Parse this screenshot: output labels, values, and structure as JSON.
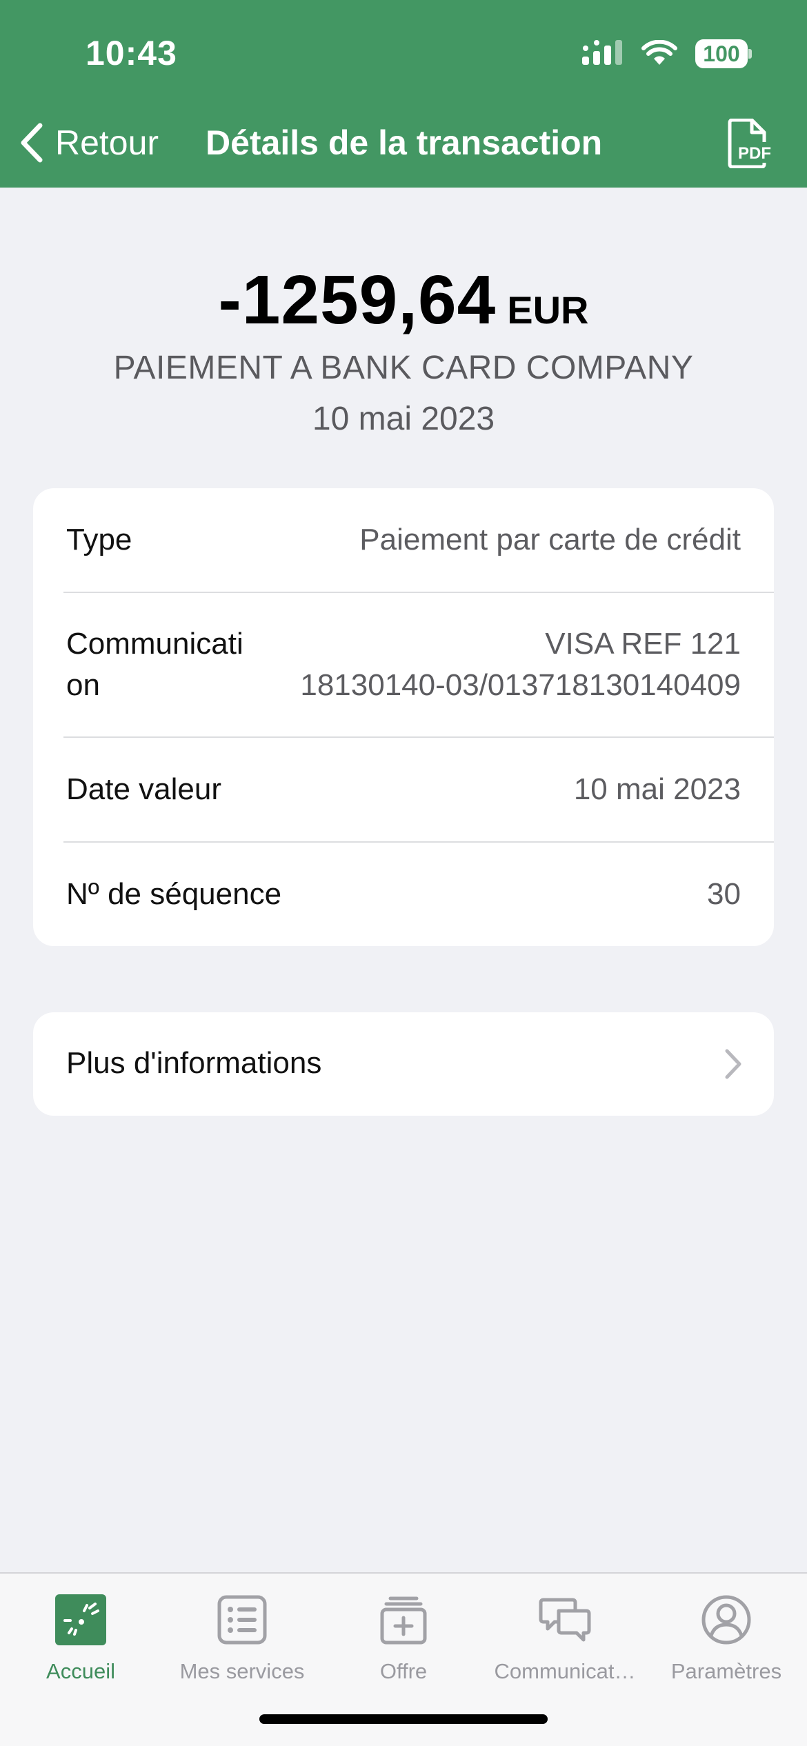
{
  "status_bar": {
    "time": "10:43",
    "battery": "100"
  },
  "nav": {
    "back_label": "Retour",
    "title": "Détails de la transaction",
    "pdf_icon_label": "PDF"
  },
  "transaction": {
    "amount": "-1259,64",
    "currency": "EUR",
    "merchant": "PAIEMENT A BANK CARD COMPANY",
    "date": "10 mai 2023"
  },
  "details": [
    {
      "label": "Type",
      "value": "Paiement par carte de crédit"
    },
    {
      "label_line1": "Communicati",
      "label_line2": "on",
      "value_line1": "VISA REF 121",
      "value_line2": "18130140-03/013718130140409"
    },
    {
      "label": "Date valeur",
      "value": "10 mai 2023"
    },
    {
      "label": "Nº de séquence",
      "value": "30"
    }
  ],
  "more_info": {
    "label": "Plus d'informations"
  },
  "tabbar": [
    {
      "label": "Accueil",
      "icon": "bank-logo-icon",
      "active": true
    },
    {
      "label": "Mes services",
      "icon": "list-icon",
      "active": false
    },
    {
      "label": "Offre",
      "icon": "offer-box-icon",
      "active": false
    },
    {
      "label": "Communicat…",
      "icon": "chat-bubbles-icon",
      "active": false
    },
    {
      "label": "Paramètres",
      "icon": "user-circle-icon",
      "active": false
    }
  ],
  "colors": {
    "brand_green": "#439763",
    "tab_active": "#3f8c5b",
    "background": "#f0f1f5"
  }
}
